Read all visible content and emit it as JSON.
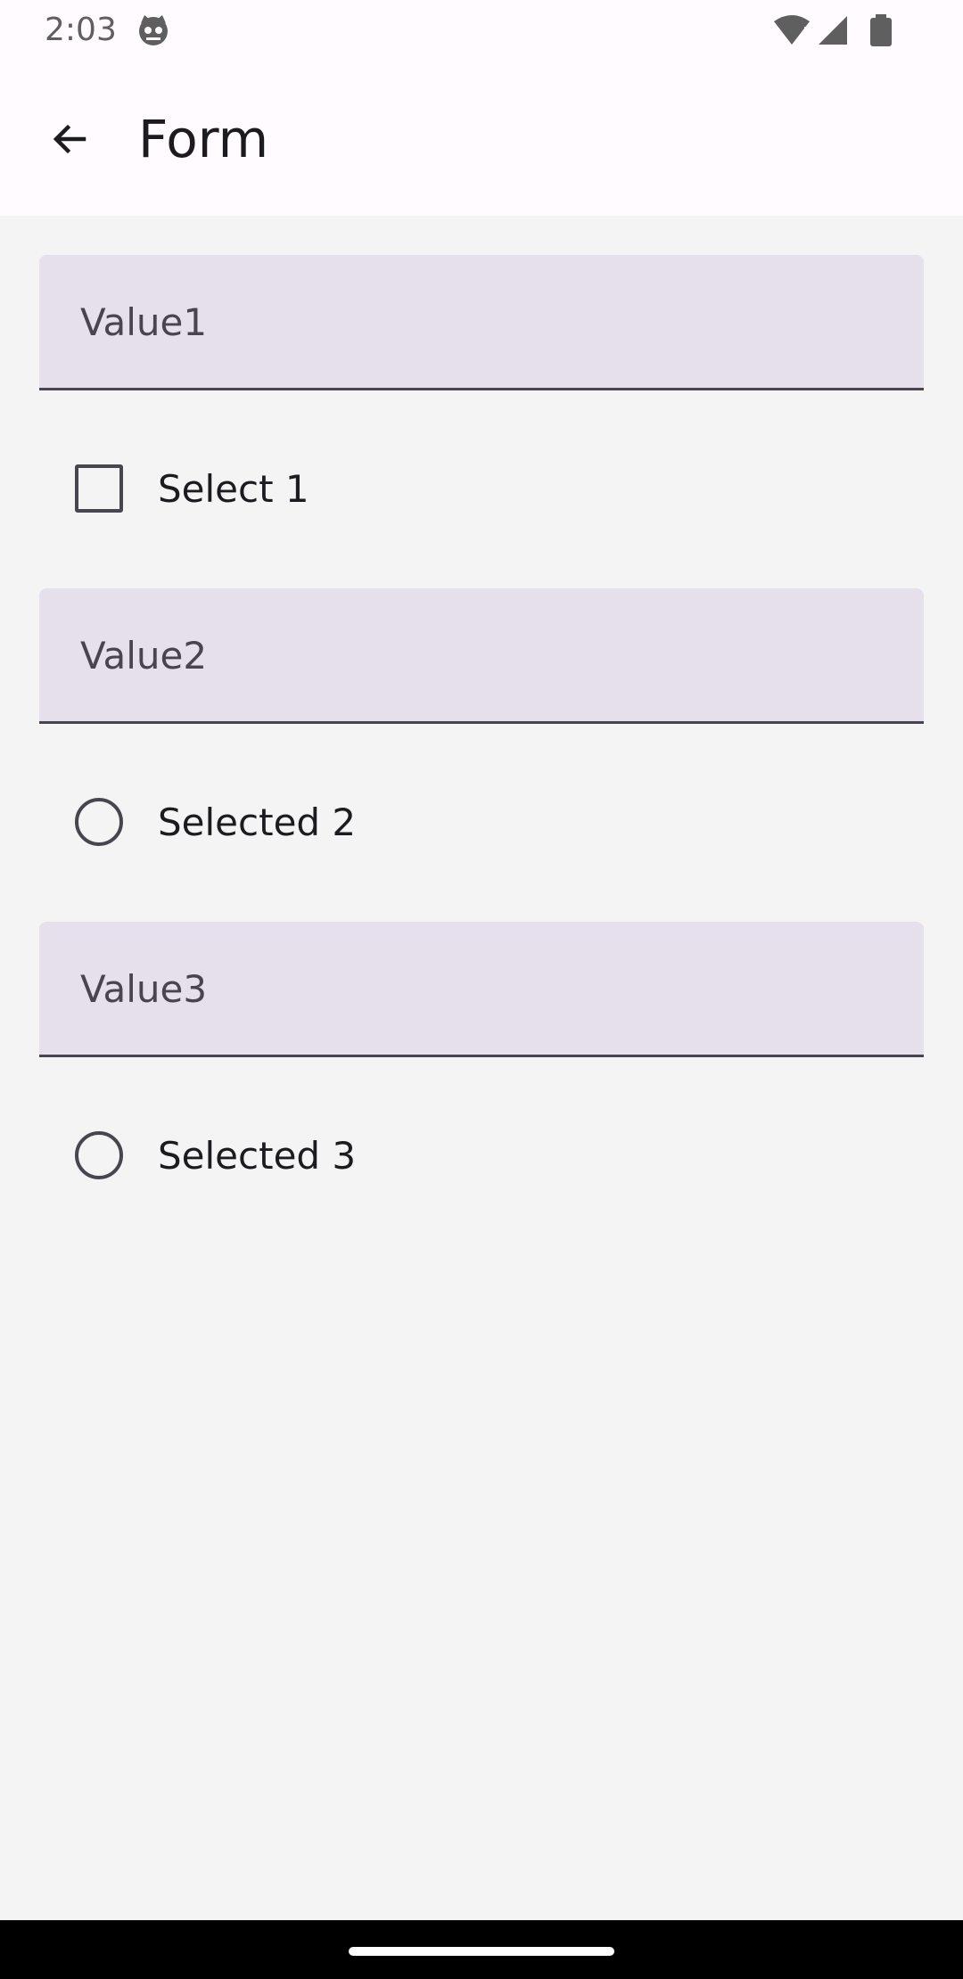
{
  "status_bar": {
    "time": "2:03",
    "icons": [
      "android-debug-icon",
      "wifi-alert-icon",
      "cell-signal-icon",
      "battery-icon"
    ]
  },
  "app_bar": {
    "back_icon": "arrow-back-icon",
    "title": "Form"
  },
  "form": {
    "field1": {
      "value": "Value1"
    },
    "option1": {
      "type": "checkbox",
      "label": "Select 1",
      "checked": false
    },
    "field2": {
      "value": "Value2"
    },
    "option2": {
      "type": "radio",
      "label": "Selected 2",
      "selected": false
    },
    "field3": {
      "value": "Value3"
    },
    "option3": {
      "type": "radio",
      "label": "Selected 3",
      "selected": false
    }
  },
  "colors": {
    "field_bg": "#e6dfec",
    "field_underline": "#49454f",
    "background": "#f4f4f4",
    "app_bar_bg": "#fffbfe"
  }
}
